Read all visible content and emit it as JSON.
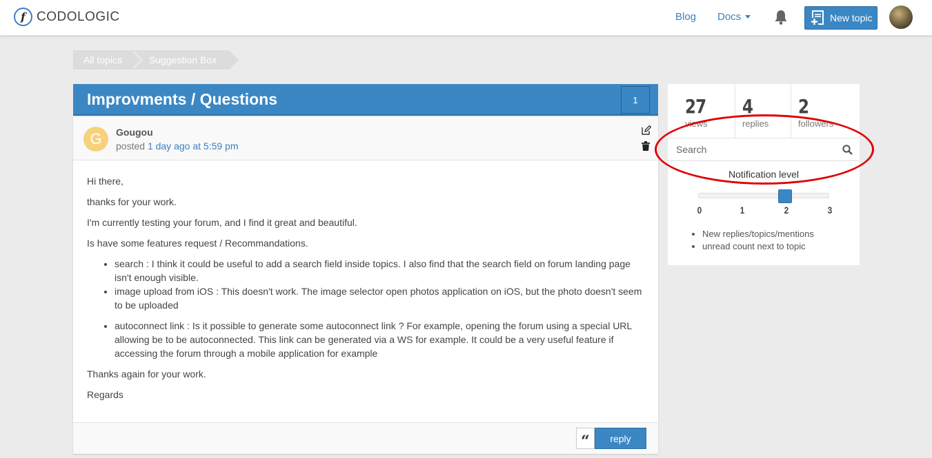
{
  "header": {
    "logo_letter": "f",
    "logo_text": "CODOLOGIC",
    "nav_blog": "Blog",
    "nav_docs": "Docs",
    "new_topic": "New topic"
  },
  "breadcrumb": [
    "All topics",
    "Suggestion Box"
  ],
  "topic": {
    "title": "Improvments / Questions",
    "count": "1"
  },
  "post": {
    "avatar_letter": "G",
    "author": "Gougou",
    "posted_prefix": "posted",
    "posted_time": "1 day ago at 5:59 pm",
    "paragraphs_before": [
      "Hi there,",
      "thanks for your work.",
      "I'm currently testing your forum, and I find it great and beautiful.",
      "Is have some features request / Recommandations."
    ],
    "list": [
      "search : I think it could be useful to add a search field inside topics. I also find that the search field on forum landing page isn't enough visible.",
      "image upload from iOS : This doesn't work. The image selector open photos application on iOS, but the photo doesn't seem to be uploaded",
      "autoconnect link : Is it possible to generate some autoconnect link ? For example, opening the forum using a special URL allowing be to be autoconnected. This link can be generated via a WS for example. It could be a very useful feature if accessing the forum through a mobile application for example"
    ],
    "paragraphs_after": [
      "Thanks again for your work.",
      "Regards"
    ],
    "quote_glyph": "“",
    "reply": "reply"
  },
  "sidebar": {
    "stats": [
      {
        "num": "27",
        "label": "views"
      },
      {
        "num": "4",
        "label": "replies"
      },
      {
        "num": "2",
        "label": "followers"
      }
    ],
    "search_placeholder": "Search",
    "notification_label": "Notification level",
    "ticks": [
      "0",
      "1",
      "2",
      "3"
    ],
    "notification_level": 2,
    "notification_items": [
      "New replies/topics/mentions",
      "unread count next to topic"
    ]
  },
  "colors": {
    "accent": "#3b87c4",
    "annotation": "#e00000"
  }
}
